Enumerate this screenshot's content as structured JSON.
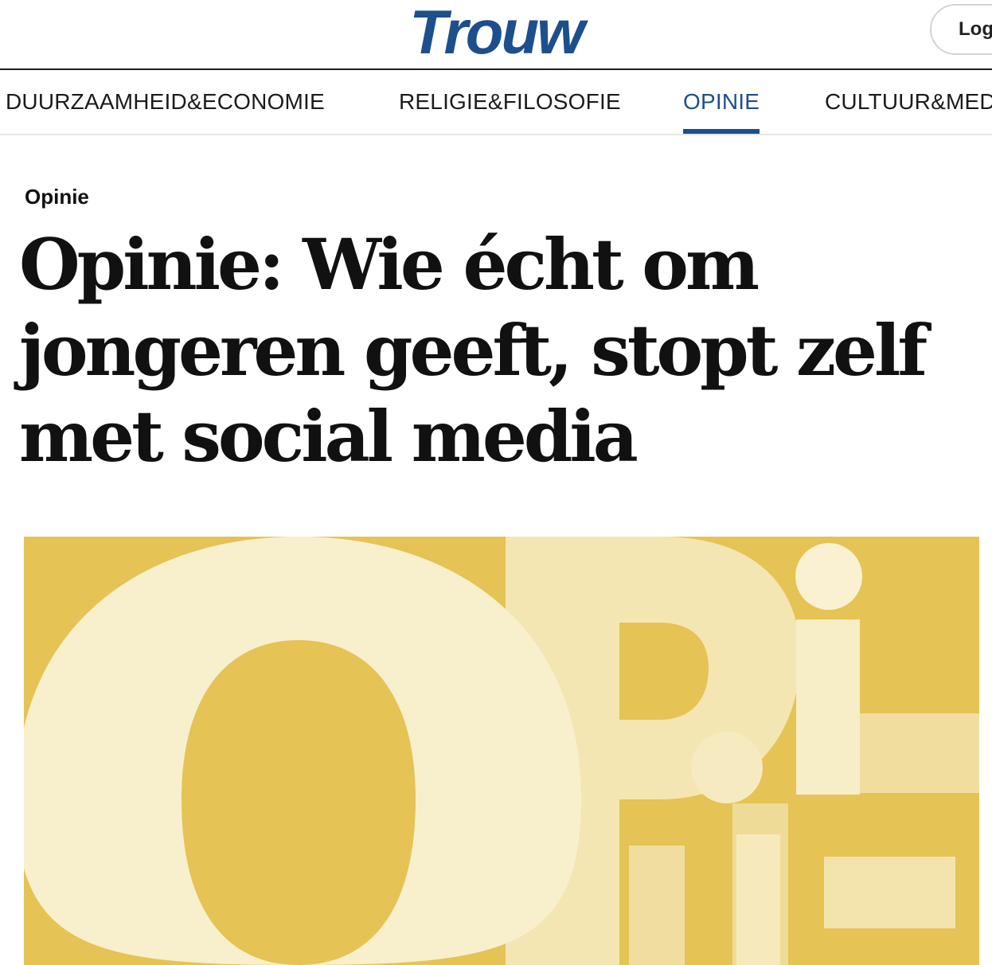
{
  "header": {
    "logo_text": "Trouw",
    "login_label": "Log"
  },
  "nav": {
    "items": [
      {
        "label": "DUURZAAMHEID&ECONOMIE"
      },
      {
        "label": "RELIGIE&FILOSOFIE"
      },
      {
        "label": "OPINIE"
      },
      {
        "label": "CULTUUR&MED"
      }
    ]
  },
  "article": {
    "category": "Opinie",
    "headline": "Opinie: Wie écht om jongeren geeft, stopt zelf met social media"
  },
  "colors": {
    "brand": "#1d4f8c",
    "hero_background": "#e5c354",
    "hero_shapes": "#f7edc3"
  }
}
